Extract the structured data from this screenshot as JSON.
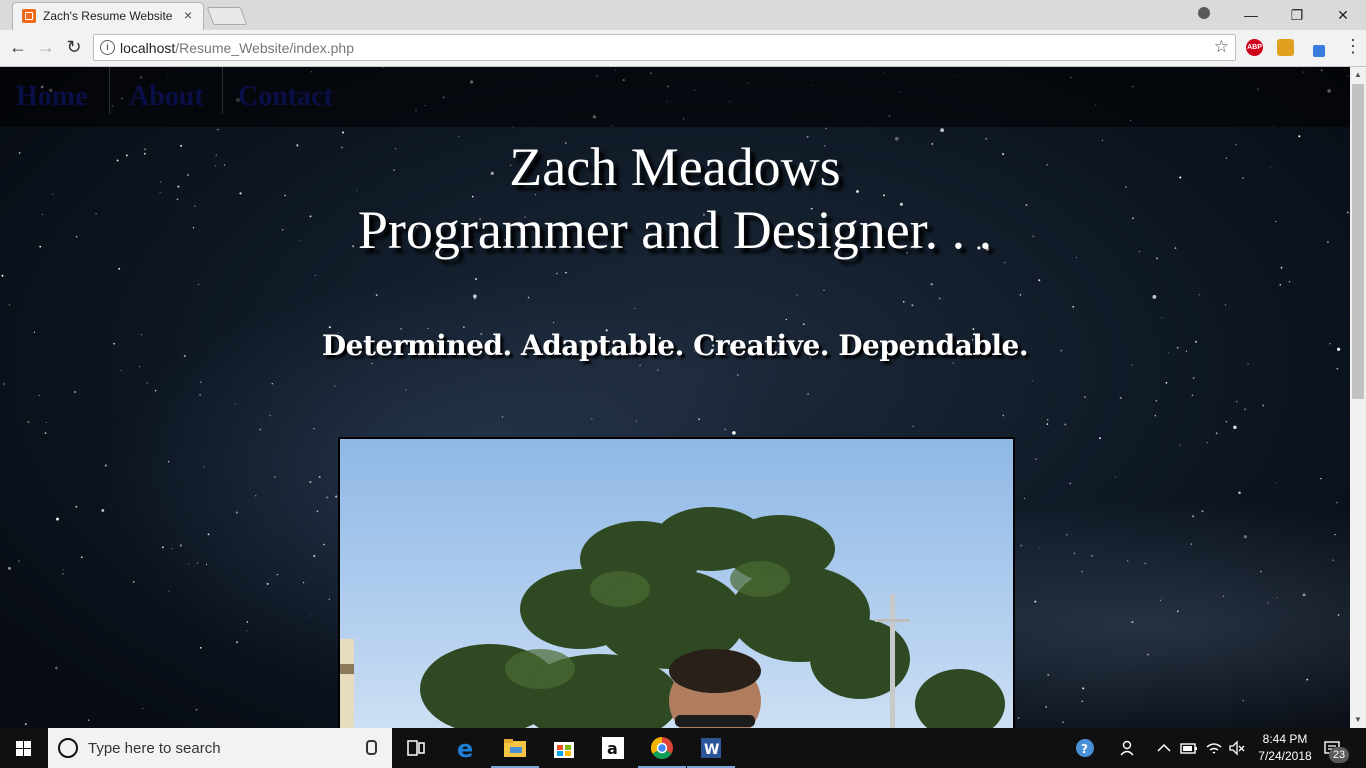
{
  "browser": {
    "tab_title": "Zach's Resume Website",
    "tab_close": "×",
    "url_host": "localhost",
    "url_path": "/Resume_Website/index.php",
    "info_glyph": "i",
    "star_glyph": "☆",
    "back_glyph": "←",
    "forward_glyph": "→",
    "reload_glyph": "↻",
    "menu_glyph": "⋮",
    "minimize_glyph": "—",
    "restore_glyph": "❐",
    "close_glyph": "✕",
    "extensions": [
      {
        "name": "adblock-plus-icon",
        "label": "ABP",
        "color": "#d0021b"
      },
      {
        "name": "color-picker-icon",
        "label": "",
        "color": "#e0a020"
      },
      {
        "name": "eyedropper-icon",
        "label": "",
        "color": "#3a7be0"
      }
    ]
  },
  "site": {
    "nav": [
      "Home",
      "About",
      "Contact"
    ],
    "name": "Zach Meadows",
    "role": "Programmer and Designer. . .",
    "tagline": "Determined. Adaptable. Creative. Dependable."
  },
  "taskbar": {
    "search_placeholder": "Type here to search",
    "time": "8:44 PM",
    "date": "7/24/2018",
    "notification_count": "23",
    "apps": [
      "task-view-icon",
      "edge-icon",
      "file-explorer-icon",
      "store-icon",
      "amazon-icon",
      "chrome-icon",
      "word-icon"
    ],
    "colors": {
      "accent": "#7da7d9",
      "edge": "#1e7fd6",
      "explorer": "#f4c542",
      "word": "#2b579a"
    }
  },
  "scrollbar": {
    "up_glyph": "▲",
    "down_glyph": "▼"
  }
}
